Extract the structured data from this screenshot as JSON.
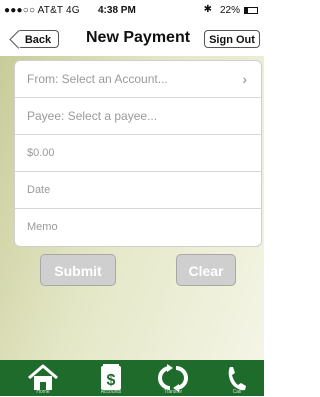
{
  "status_bar": {
    "carrier": "●●●○○ AT&T  4G",
    "time": "4:38 PM",
    "bluetooth": "✱",
    "battery_pct": "22%",
    "battery_level": 0.22
  },
  "nav": {
    "back_label": "Back",
    "title": "New Payment",
    "signout_label": "Sign Out"
  },
  "form": {
    "from_placeholder": "From: Select an Account...",
    "payee_placeholder": "Payee: Select a payee...",
    "amount_placeholder": "$0.00",
    "date_placeholder": "Date",
    "memo_placeholder": "Memo",
    "chevron": "›"
  },
  "actions": {
    "submit_label": "Submit",
    "clear_label": "Clear"
  },
  "tabbar": {
    "items": [
      {
        "label": "Home",
        "icon": "home-icon"
      },
      {
        "label": "Accounts",
        "icon": "dollar-icon"
      },
      {
        "label": "Transfer",
        "icon": "transfer-icon"
      },
      {
        "label": "Call",
        "icon": "phone-icon"
      }
    ]
  },
  "colors": {
    "tabbar_bg": "#1f6b2b",
    "content_gradient_start": "#c8cc99",
    "button_disabled": "#cfcfcf"
  }
}
